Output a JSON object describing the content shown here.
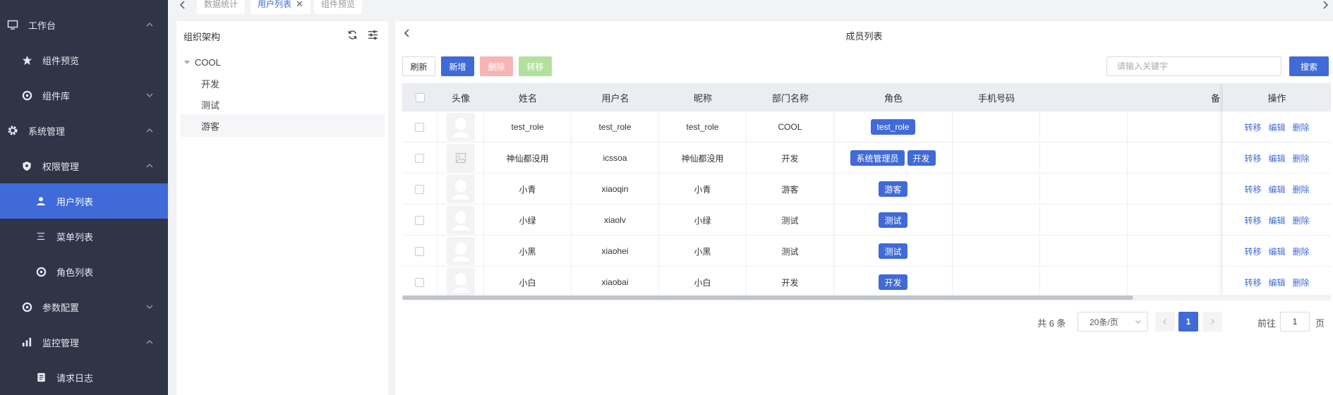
{
  "sidebar": {
    "items": [
      {
        "label": "工作台",
        "icon": "monitor-icon",
        "level": 0,
        "arrow": "up"
      },
      {
        "label": "组件预览",
        "icon": "star-icon",
        "level": 1,
        "arrow": ""
      },
      {
        "label": "组件库",
        "icon": "circle-dot-icon",
        "level": 1,
        "arrow": "down"
      },
      {
        "label": "系统管理",
        "icon": "gear-icon",
        "level": 0,
        "arrow": "up"
      },
      {
        "label": "权限管理",
        "icon": "shield-icon",
        "level": 1,
        "arrow": "up"
      },
      {
        "label": "用户列表",
        "icon": "user-icon",
        "level": 2,
        "arrow": "",
        "active": true
      },
      {
        "label": "菜单列表",
        "icon": "menu-lines-icon",
        "level": 2,
        "arrow": ""
      },
      {
        "label": "角色列表",
        "icon": "circle-dot-icon",
        "level": 2,
        "arrow": ""
      },
      {
        "label": "参数配置",
        "icon": "circle-dot-icon",
        "level": 1,
        "arrow": "down"
      },
      {
        "label": "监控管理",
        "icon": "bar-chart-icon",
        "level": 1,
        "arrow": "up"
      },
      {
        "label": "请求日志",
        "icon": "log-icon",
        "level": 2,
        "arrow": ""
      }
    ]
  },
  "tabs": [
    {
      "label": "数据统计",
      "active": false
    },
    {
      "label": "用户列表",
      "active": true,
      "close": "✕"
    },
    {
      "label": "组件预览",
      "active": false
    }
  ],
  "org": {
    "title": "组织架构",
    "root": "COOL",
    "children": [
      "开发",
      "测试",
      "游客"
    ],
    "selected": "游客"
  },
  "main": {
    "title": "成员列表",
    "buttons": {
      "refresh": "刷新",
      "add": "新增",
      "delete": "删除",
      "move": "转移",
      "search": "搜索"
    },
    "search_placeholder": "请输入关键字"
  },
  "table": {
    "headers": {
      "avatar": "头像",
      "name": "姓名",
      "username": "用户名",
      "nickname": "昵称",
      "dept": "部门名称",
      "role": "角色",
      "phone": "手机号码",
      "remark": "备",
      "ops": "操作"
    },
    "ops": {
      "move": "转移",
      "edit": "编辑",
      "delete": "删除"
    },
    "rows": [
      {
        "name": "test_role",
        "username": "test_role",
        "nickname": "test_role",
        "dept": "COOL",
        "roles": [
          "test_role"
        ],
        "avatar": "person"
      },
      {
        "name": "神仙都没用",
        "username": "icssoa",
        "nickname": "神仙都没用",
        "dept": "开发",
        "roles": [
          "系统管理员",
          "开发"
        ],
        "avatar": "image"
      },
      {
        "name": "小青",
        "username": "xiaoqin",
        "nickname": "小青",
        "dept": "游客",
        "roles": [
          "游客"
        ],
        "avatar": "person"
      },
      {
        "name": "小绿",
        "username": "xiaolv",
        "nickname": "小绿",
        "dept": "测试",
        "roles": [
          "测试"
        ],
        "avatar": "person"
      },
      {
        "name": "小黑",
        "username": "xiaohei",
        "nickname": "小黑",
        "dept": "测试",
        "roles": [
          "测试"
        ],
        "avatar": "person"
      },
      {
        "name": "小白",
        "username": "xiaobai",
        "nickname": "小白",
        "dept": "开发",
        "roles": [
          "开发"
        ],
        "avatar": "person"
      }
    ]
  },
  "pagination": {
    "total_text": "共 6 条",
    "page_size": "20条/页",
    "current_page": "1",
    "goto_label": "前往",
    "goto_value": "1",
    "page_suffix": "页"
  },
  "colors": {
    "sidebar_bg": "#2f3447",
    "accent": "#3f6ad8",
    "danger_disabled": "#f8b4b4",
    "success_disabled": "#b3e19d"
  }
}
